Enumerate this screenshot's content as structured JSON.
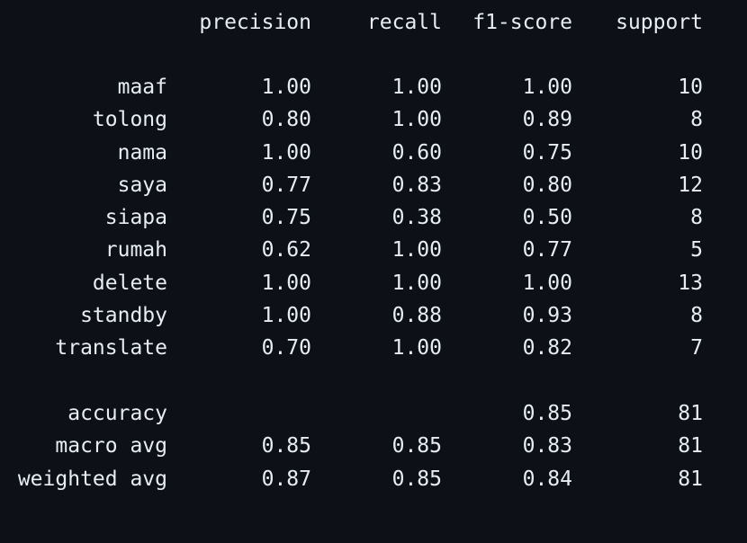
{
  "report": {
    "headers": [
      "precision",
      "recall",
      "f1-score",
      "support"
    ],
    "rows": [
      {
        "label": "maaf",
        "precision": "1.00",
        "recall": "1.00",
        "f1": "1.00",
        "support": "10"
      },
      {
        "label": "tolong",
        "precision": "0.80",
        "recall": "1.00",
        "f1": "0.89",
        "support": "8"
      },
      {
        "label": "nama",
        "precision": "1.00",
        "recall": "0.60",
        "f1": "0.75",
        "support": "10"
      },
      {
        "label": "saya",
        "precision": "0.77",
        "recall": "0.83",
        "f1": "0.80",
        "support": "12"
      },
      {
        "label": "siapa",
        "precision": "0.75",
        "recall": "0.38",
        "f1": "0.50",
        "support": "8"
      },
      {
        "label": "rumah",
        "precision": "0.62",
        "recall": "1.00",
        "f1": "0.77",
        "support": "5"
      },
      {
        "label": "delete",
        "precision": "1.00",
        "recall": "1.00",
        "f1": "1.00",
        "support": "13"
      },
      {
        "label": "standby",
        "precision": "1.00",
        "recall": "0.88",
        "f1": "0.93",
        "support": "8"
      },
      {
        "label": "translate",
        "precision": "0.70",
        "recall": "1.00",
        "f1": "0.82",
        "support": "7"
      }
    ],
    "summary": [
      {
        "label": "accuracy",
        "precision": "",
        "recall": "",
        "f1": "0.85",
        "support": "81"
      },
      {
        "label": "macro avg",
        "precision": "0.85",
        "recall": "0.85",
        "f1": "0.83",
        "support": "81"
      },
      {
        "label": "weighted avg",
        "precision": "0.87",
        "recall": "0.85",
        "f1": "0.84",
        "support": "81"
      }
    ]
  },
  "colors": {
    "background": "#0d1117",
    "text": "#e6edf3"
  }
}
